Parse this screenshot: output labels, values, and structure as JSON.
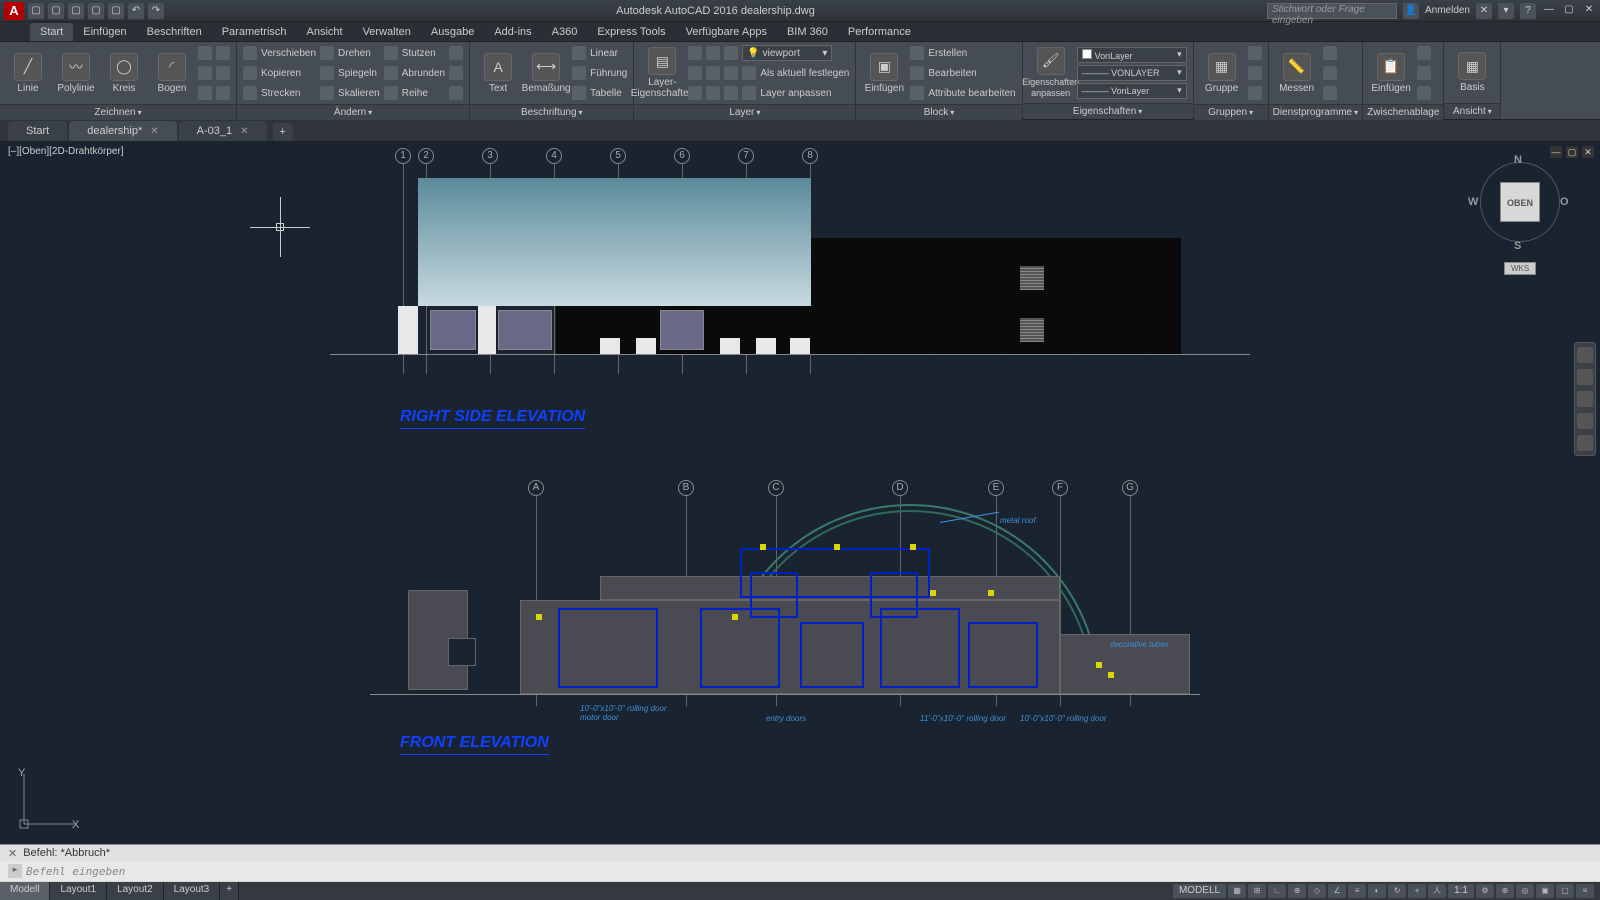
{
  "app": {
    "title": "Autodesk AutoCAD 2016   dealership.dwg",
    "search_placeholder": "Stichwort oder Frage eingeben",
    "signin": "Anmelden"
  },
  "menu": {
    "tabs": [
      "Start",
      "Einfügen",
      "Beschriften",
      "Parametrisch",
      "Ansicht",
      "Verwalten",
      "Ausgabe",
      "Add-ins",
      "A360",
      "Express Tools",
      "Verfügbare Apps",
      "BIM 360",
      "Performance"
    ],
    "active": 0
  },
  "ribbon": {
    "draw": {
      "title": "Zeichnen",
      "linie": "Linie",
      "polylinie": "Polylinie",
      "kreis": "Kreis",
      "bogen": "Bogen"
    },
    "modify": {
      "title": "Ändern",
      "verschieben": "Verschieben",
      "kopieren": "Kopieren",
      "strecken": "Strecken",
      "drehen": "Drehen",
      "spiegeln": "Spiegeln",
      "skalieren": "Skalieren",
      "stutzen": "Stutzen",
      "abrunden": "Abrunden",
      "reihe": "Reihe"
    },
    "annotate": {
      "title": "Beschriftung",
      "text": "Text",
      "bemassung": "Bemaßung",
      "linear": "Linear",
      "fuehrung": "Führung",
      "tabelle": "Tabelle"
    },
    "layers": {
      "title": "Layer",
      "eigenschaften": "Layer-Eigenschaften",
      "current": "viewport",
      "aktuell": "Als aktuell festlegen",
      "anpassen": "Layer anpassen"
    },
    "block": {
      "title": "Block",
      "einfuegen": "Einfügen",
      "erstellen": "Erstellen",
      "bearbeiten": "Bearbeiten",
      "attr": "Attribute bearbeiten"
    },
    "properties": {
      "title": "Eigenschaften",
      "eigenschaften": "Eigenschaften",
      "anpassen": "anpassen",
      "color": "VonLayer",
      "ltype": "VONLAYER",
      "lweight": "VonLayer"
    },
    "groups": {
      "title": "Gruppen",
      "gruppe": "Gruppe"
    },
    "utilities": {
      "title": "Dienstprogramme",
      "messen": "Messen"
    },
    "clipboard": {
      "title": "Zwischenablage",
      "einfuegen": "Einfügen"
    },
    "view": {
      "title": "Ansicht",
      "basis": "Basis"
    }
  },
  "files": {
    "tabs": [
      {
        "label": "Start",
        "active": false,
        "closeable": false
      },
      {
        "label": "dealership*",
        "active": true,
        "closeable": true
      },
      {
        "label": "A-03_1",
        "active": false,
        "closeable": true
      }
    ]
  },
  "viewport": {
    "label": "[–][Oben][2D-Drahtkörper]",
    "elev1_title": "RIGHT SIDE ELEVATION",
    "elev1_grids": [
      "1",
      "2",
      "3",
      "4",
      "5",
      "6",
      "7",
      "8"
    ],
    "elev2_title": "FRONT ELEVATION",
    "elev2_grids": [
      "A",
      "B",
      "C",
      "D",
      "E",
      "F",
      "G"
    ],
    "anno_roof": "metal roof",
    "anno_door1": "10'-0\"x10'-0\" rolling door motor door",
    "anno_door2": "entry doors",
    "anno_door3": "11'-0\"x10'-0\" rolling door",
    "anno_door4": "10'-0\"x10'-0\" rolling door",
    "anno_decor": "decorative tubes"
  },
  "viewcube": {
    "face": "OBEN",
    "n": "N",
    "s": "S",
    "e": "O",
    "w": "W",
    "wks": "WKS"
  },
  "ucs": {
    "x": "X",
    "y": "Y"
  },
  "command": {
    "history": "Befehl: *Abbruch*",
    "prompt": "Befehl eingeben"
  },
  "bottom": {
    "tabs": [
      "Modell",
      "Layout1",
      "Layout2",
      "Layout3"
    ],
    "active": 0,
    "model": "MODELL",
    "scale": "1:1"
  }
}
